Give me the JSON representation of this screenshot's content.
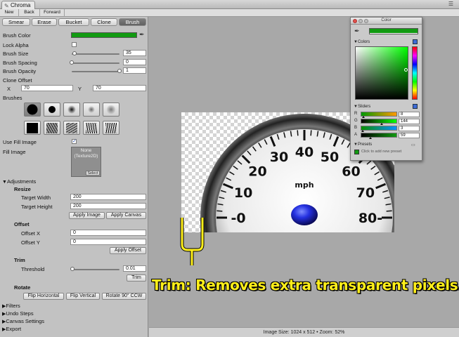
{
  "app": {
    "tab_title": "Chroma",
    "tab_icon": "brush-icon"
  },
  "nav": {
    "new": "New",
    "back": "Back",
    "forward": "Forward"
  },
  "tools": [
    "Smear",
    "Erase",
    "Bucket",
    "Clone",
    "Brush"
  ],
  "active_tool": "Brush",
  "brush": {
    "color_label": "Brush Color",
    "color": "#119a11",
    "lock_alpha_label": "Lock Alpha",
    "lock_alpha": false,
    "size_label": "Brush Size",
    "size": "35",
    "size_fraction": 0.06,
    "spacing_label": "Brush Spacing",
    "spacing": "0",
    "spacing_fraction": 0.0,
    "opacity_label": "Brush Opacity",
    "opacity": "1",
    "opacity_fraction": 1.0,
    "clone_offset_label": "Clone Offset",
    "x_label": "X",
    "x": "70",
    "y_label": "Y",
    "y": "70",
    "brushes_label": "Brushes"
  },
  "fill": {
    "use_fill_label": "Use Fill Image",
    "use_fill": true,
    "fill_image_label": "Fill Image",
    "fill_value": "None",
    "fill_type": "(Texture2D)",
    "select": "Select"
  },
  "adjustments": {
    "label": "Adjustments",
    "resize": {
      "label": "Resize",
      "width_label": "Target Width",
      "width": "200",
      "height_label": "Target Height",
      "height": "200",
      "apply_image": "Apply Image",
      "apply_canvas": "Apply Canvas"
    },
    "offset": {
      "label": "Offset",
      "x_label": "Offset X",
      "x": "0",
      "y_label": "Offset Y",
      "y": "0",
      "apply": "Apply Offset"
    },
    "trim": {
      "label": "Trim",
      "threshold_label": "Threshold",
      "threshold": "0.01",
      "threshold_fraction": 0.01,
      "button": "Trim"
    },
    "rotate": {
      "label": "Rotate",
      "flip_h": "Flip Horizontal",
      "flip_v": "Flip Vertical",
      "rotate90": "Rotate 90° CCW"
    }
  },
  "foldouts": [
    "Filters",
    "Undo Steps",
    "Canvas Settings",
    "Export"
  ],
  "status": "Image Size: 1024 x 512 • Zoom: 52%",
  "speedometer": {
    "unit": "mph",
    "ticks": [
      "0",
      "10",
      "20",
      "30",
      "40",
      "50",
      "60",
      "70",
      "80"
    ]
  },
  "annotation": "Trim:  Removes extra transparent pixels.",
  "color_window": {
    "title": "Color",
    "current_color": "#119a11",
    "colors_label": "Colors",
    "sliders_label": "Sliders",
    "channels": [
      {
        "name": "R",
        "value": "8",
        "fraction": 0.03
      },
      {
        "name": "G",
        "value": "144",
        "fraction": 0.565
      },
      {
        "name": "B",
        "value": "3",
        "fraction": 0.01
      },
      {
        "name": "A",
        "value": "59",
        "fraction": 0.23
      }
    ],
    "presets_label": "Presets",
    "add_preset": "Click to add new preset"
  }
}
